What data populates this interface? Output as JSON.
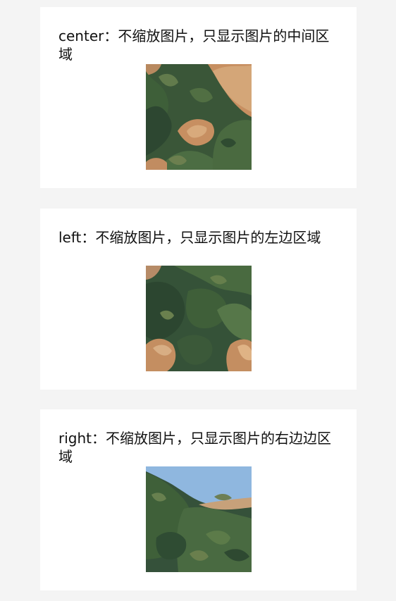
{
  "examples": [
    {
      "mode": "center",
      "text": "center：不缩放图片，只显示图片的中间区域"
    },
    {
      "mode": "left",
      "text": "left：不缩放图片，只显示图片的左边区域"
    },
    {
      "mode": "right",
      "text": "right：不缩放图片，只显示图片的右边边区域"
    }
  ],
  "colors": {
    "page_background": "#f4f4f4",
    "card_background": "#ffffff",
    "text": "#111111",
    "foliage_dark": "#2f4a32",
    "foliage_mid": "#3f5c3a",
    "rock": "#c98a5a",
    "rock_light": "#d9a97d",
    "sky": "#8fb7df"
  },
  "icons": {
    "image": "landscape-photo"
  }
}
